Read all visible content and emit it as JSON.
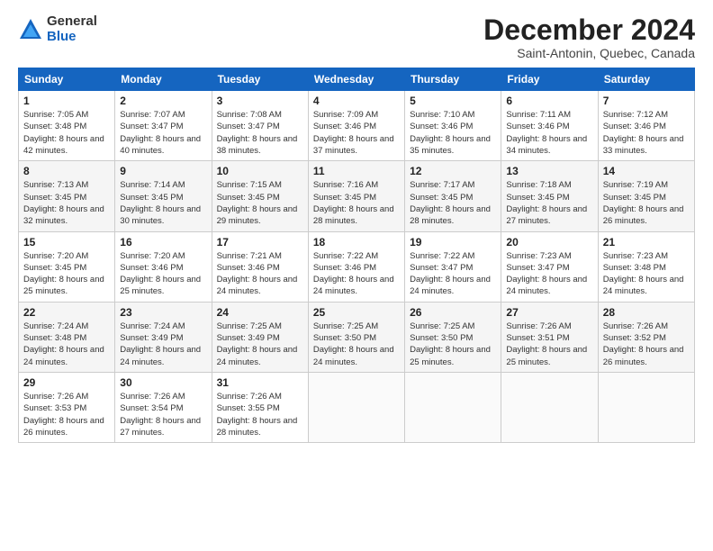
{
  "logo": {
    "general": "General",
    "blue": "Blue"
  },
  "header": {
    "month": "December 2024",
    "location": "Saint-Antonin, Quebec, Canada"
  },
  "weekdays": [
    "Sunday",
    "Monday",
    "Tuesday",
    "Wednesday",
    "Thursday",
    "Friday",
    "Saturday"
  ],
  "weeks": [
    [
      {
        "day": 1,
        "sunrise": "Sunrise: 7:05 AM",
        "sunset": "Sunset: 3:48 PM",
        "daylight": "Daylight: 8 hours and 42 minutes."
      },
      {
        "day": 2,
        "sunrise": "Sunrise: 7:07 AM",
        "sunset": "Sunset: 3:47 PM",
        "daylight": "Daylight: 8 hours and 40 minutes."
      },
      {
        "day": 3,
        "sunrise": "Sunrise: 7:08 AM",
        "sunset": "Sunset: 3:47 PM",
        "daylight": "Daylight: 8 hours and 38 minutes."
      },
      {
        "day": 4,
        "sunrise": "Sunrise: 7:09 AM",
        "sunset": "Sunset: 3:46 PM",
        "daylight": "Daylight: 8 hours and 37 minutes."
      },
      {
        "day": 5,
        "sunrise": "Sunrise: 7:10 AM",
        "sunset": "Sunset: 3:46 PM",
        "daylight": "Daylight: 8 hours and 35 minutes."
      },
      {
        "day": 6,
        "sunrise": "Sunrise: 7:11 AM",
        "sunset": "Sunset: 3:46 PM",
        "daylight": "Daylight: 8 hours and 34 minutes."
      },
      {
        "day": 7,
        "sunrise": "Sunrise: 7:12 AM",
        "sunset": "Sunset: 3:46 PM",
        "daylight": "Daylight: 8 hours and 33 minutes."
      }
    ],
    [
      {
        "day": 8,
        "sunrise": "Sunrise: 7:13 AM",
        "sunset": "Sunset: 3:45 PM",
        "daylight": "Daylight: 8 hours and 32 minutes."
      },
      {
        "day": 9,
        "sunrise": "Sunrise: 7:14 AM",
        "sunset": "Sunset: 3:45 PM",
        "daylight": "Daylight: 8 hours and 30 minutes."
      },
      {
        "day": 10,
        "sunrise": "Sunrise: 7:15 AM",
        "sunset": "Sunset: 3:45 PM",
        "daylight": "Daylight: 8 hours and 29 minutes."
      },
      {
        "day": 11,
        "sunrise": "Sunrise: 7:16 AM",
        "sunset": "Sunset: 3:45 PM",
        "daylight": "Daylight: 8 hours and 28 minutes."
      },
      {
        "day": 12,
        "sunrise": "Sunrise: 7:17 AM",
        "sunset": "Sunset: 3:45 PM",
        "daylight": "Daylight: 8 hours and 28 minutes."
      },
      {
        "day": 13,
        "sunrise": "Sunrise: 7:18 AM",
        "sunset": "Sunset: 3:45 PM",
        "daylight": "Daylight: 8 hours and 27 minutes."
      },
      {
        "day": 14,
        "sunrise": "Sunrise: 7:19 AM",
        "sunset": "Sunset: 3:45 PM",
        "daylight": "Daylight: 8 hours and 26 minutes."
      }
    ],
    [
      {
        "day": 15,
        "sunrise": "Sunrise: 7:20 AM",
        "sunset": "Sunset: 3:45 PM",
        "daylight": "Daylight: 8 hours and 25 minutes."
      },
      {
        "day": 16,
        "sunrise": "Sunrise: 7:20 AM",
        "sunset": "Sunset: 3:46 PM",
        "daylight": "Daylight: 8 hours and 25 minutes."
      },
      {
        "day": 17,
        "sunrise": "Sunrise: 7:21 AM",
        "sunset": "Sunset: 3:46 PM",
        "daylight": "Daylight: 8 hours and 24 minutes."
      },
      {
        "day": 18,
        "sunrise": "Sunrise: 7:22 AM",
        "sunset": "Sunset: 3:46 PM",
        "daylight": "Daylight: 8 hours and 24 minutes."
      },
      {
        "day": 19,
        "sunrise": "Sunrise: 7:22 AM",
        "sunset": "Sunset: 3:47 PM",
        "daylight": "Daylight: 8 hours and 24 minutes."
      },
      {
        "day": 20,
        "sunrise": "Sunrise: 7:23 AM",
        "sunset": "Sunset: 3:47 PM",
        "daylight": "Daylight: 8 hours and 24 minutes."
      },
      {
        "day": 21,
        "sunrise": "Sunrise: 7:23 AM",
        "sunset": "Sunset: 3:48 PM",
        "daylight": "Daylight: 8 hours and 24 minutes."
      }
    ],
    [
      {
        "day": 22,
        "sunrise": "Sunrise: 7:24 AM",
        "sunset": "Sunset: 3:48 PM",
        "daylight": "Daylight: 8 hours and 24 minutes."
      },
      {
        "day": 23,
        "sunrise": "Sunrise: 7:24 AM",
        "sunset": "Sunset: 3:49 PM",
        "daylight": "Daylight: 8 hours and 24 minutes."
      },
      {
        "day": 24,
        "sunrise": "Sunrise: 7:25 AM",
        "sunset": "Sunset: 3:49 PM",
        "daylight": "Daylight: 8 hours and 24 minutes."
      },
      {
        "day": 25,
        "sunrise": "Sunrise: 7:25 AM",
        "sunset": "Sunset: 3:50 PM",
        "daylight": "Daylight: 8 hours and 24 minutes."
      },
      {
        "day": 26,
        "sunrise": "Sunrise: 7:25 AM",
        "sunset": "Sunset: 3:50 PM",
        "daylight": "Daylight: 8 hours and 25 minutes."
      },
      {
        "day": 27,
        "sunrise": "Sunrise: 7:26 AM",
        "sunset": "Sunset: 3:51 PM",
        "daylight": "Daylight: 8 hours and 25 minutes."
      },
      {
        "day": 28,
        "sunrise": "Sunrise: 7:26 AM",
        "sunset": "Sunset: 3:52 PM",
        "daylight": "Daylight: 8 hours and 26 minutes."
      }
    ],
    [
      {
        "day": 29,
        "sunrise": "Sunrise: 7:26 AM",
        "sunset": "Sunset: 3:53 PM",
        "daylight": "Daylight: 8 hours and 26 minutes."
      },
      {
        "day": 30,
        "sunrise": "Sunrise: 7:26 AM",
        "sunset": "Sunset: 3:54 PM",
        "daylight": "Daylight: 8 hours and 27 minutes."
      },
      {
        "day": 31,
        "sunrise": "Sunrise: 7:26 AM",
        "sunset": "Sunset: 3:55 PM",
        "daylight": "Daylight: 8 hours and 28 minutes."
      },
      null,
      null,
      null,
      null
    ]
  ]
}
